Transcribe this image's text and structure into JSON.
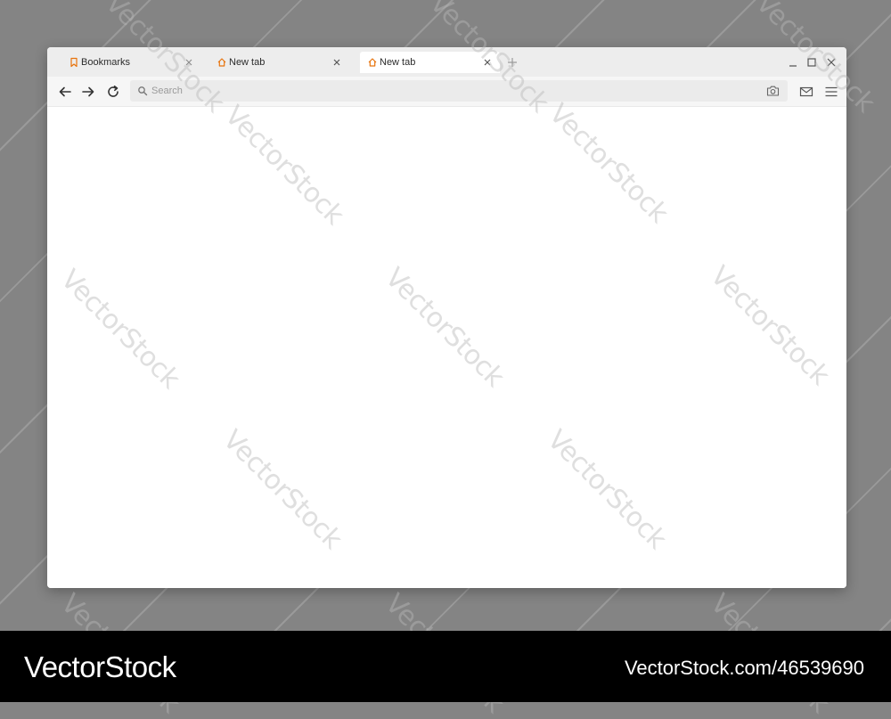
{
  "colors": {
    "tab_icon_accent": "#e8730c",
    "page_background": "#848484",
    "titlebar": "#ededed",
    "toolbar": "#f6f6f6",
    "address_bar": "#ebebeb",
    "icon_gray": "#555555"
  },
  "tabs": [
    {
      "label": "Bookmarks",
      "icon": "bookmark-icon",
      "active": false
    },
    {
      "label": "New tab",
      "icon": "home-icon",
      "active": false
    },
    {
      "label": "New tab",
      "icon": "home-icon",
      "active": true
    }
  ],
  "new_tab_icon": "plus-icon",
  "window_controls": [
    "minimize-icon",
    "maximize-icon",
    "close-icon"
  ],
  "toolbar": {
    "nav_icons": [
      "arrow-left-icon",
      "arrow-right-icon",
      "reload-icon"
    ],
    "search": {
      "placeholder": "Search",
      "value": "",
      "icon": "search-icon",
      "right_icon": "camera-icon"
    },
    "right_icons": [
      "mail-icon",
      "menu-icon"
    ]
  },
  "watermark": {
    "text": "VectorStock"
  },
  "footer": {
    "brand": "VectorStock",
    "image_id": "VectorStock.com/46539690"
  }
}
